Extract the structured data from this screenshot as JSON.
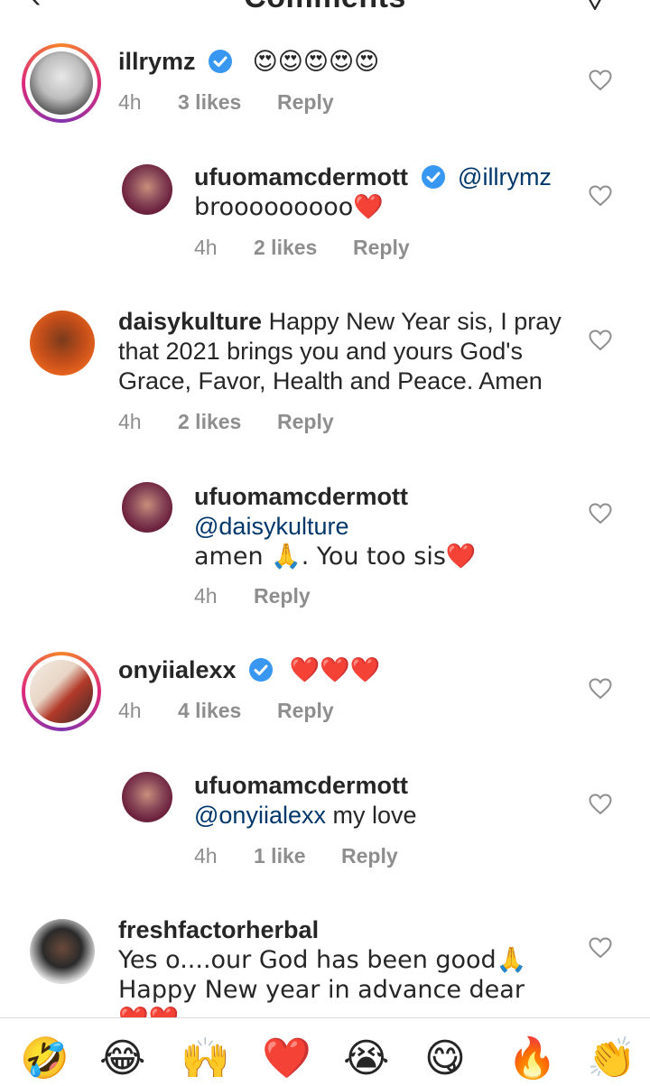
{
  "header": {
    "title": "Comments",
    "back_icon": "back-arrow-icon",
    "send_icon": "paper-plane-icon"
  },
  "comments": [
    {
      "username": "illrymz",
      "verified": true,
      "text": "😍😍😍😍😍",
      "time": "4h",
      "likes": "3 likes",
      "reply": "Reply"
    },
    {
      "username": "ufuomamcdermott",
      "verified": true,
      "mention": "@illrymz",
      "text": "brooooooooo❤️",
      "time": "4h",
      "likes": "2 likes",
      "reply": "Reply"
    },
    {
      "username": "daisykulture",
      "verified": false,
      "text": "Happy New Year sis, I pray that 2021 brings you and yours God's Grace, Favor, Health and Peace. Amen",
      "time": "4h",
      "likes": "2 likes",
      "reply": "Reply"
    },
    {
      "username": "ufuomamcdermott",
      "verified": false,
      "mention": "@daisykulture",
      "text": " amen 🙏. You too sis❤️",
      "time": "4h",
      "likes": "",
      "reply": "Reply"
    },
    {
      "username": "onyiialexx",
      "verified": true,
      "text": "❤️❤️❤️",
      "time": "4h",
      "likes": "4 likes",
      "reply": "Reply"
    },
    {
      "username": "ufuomamcdermott",
      "verified": false,
      "mention": "@onyiialexx",
      "text": " my love",
      "time": "4h",
      "likes": "1 like",
      "reply": "Reply"
    },
    {
      "username": "freshfactorherbal",
      "verified": false,
      "text": "Yes o....our God has been good🙏 Happy New year in advance dear❤️❤️",
      "time": "",
      "likes": "",
      "reply": ""
    }
  ],
  "emoji_bar": [
    "🤣",
    "😂",
    "🙌",
    "❤️",
    "😭",
    "😋",
    "🔥",
    "👏"
  ],
  "colors": {
    "text": "#262626",
    "meta": "#8e8e8e",
    "mention": "#00376b",
    "verified": "#3897f0",
    "divider": "#dbdbdb"
  }
}
